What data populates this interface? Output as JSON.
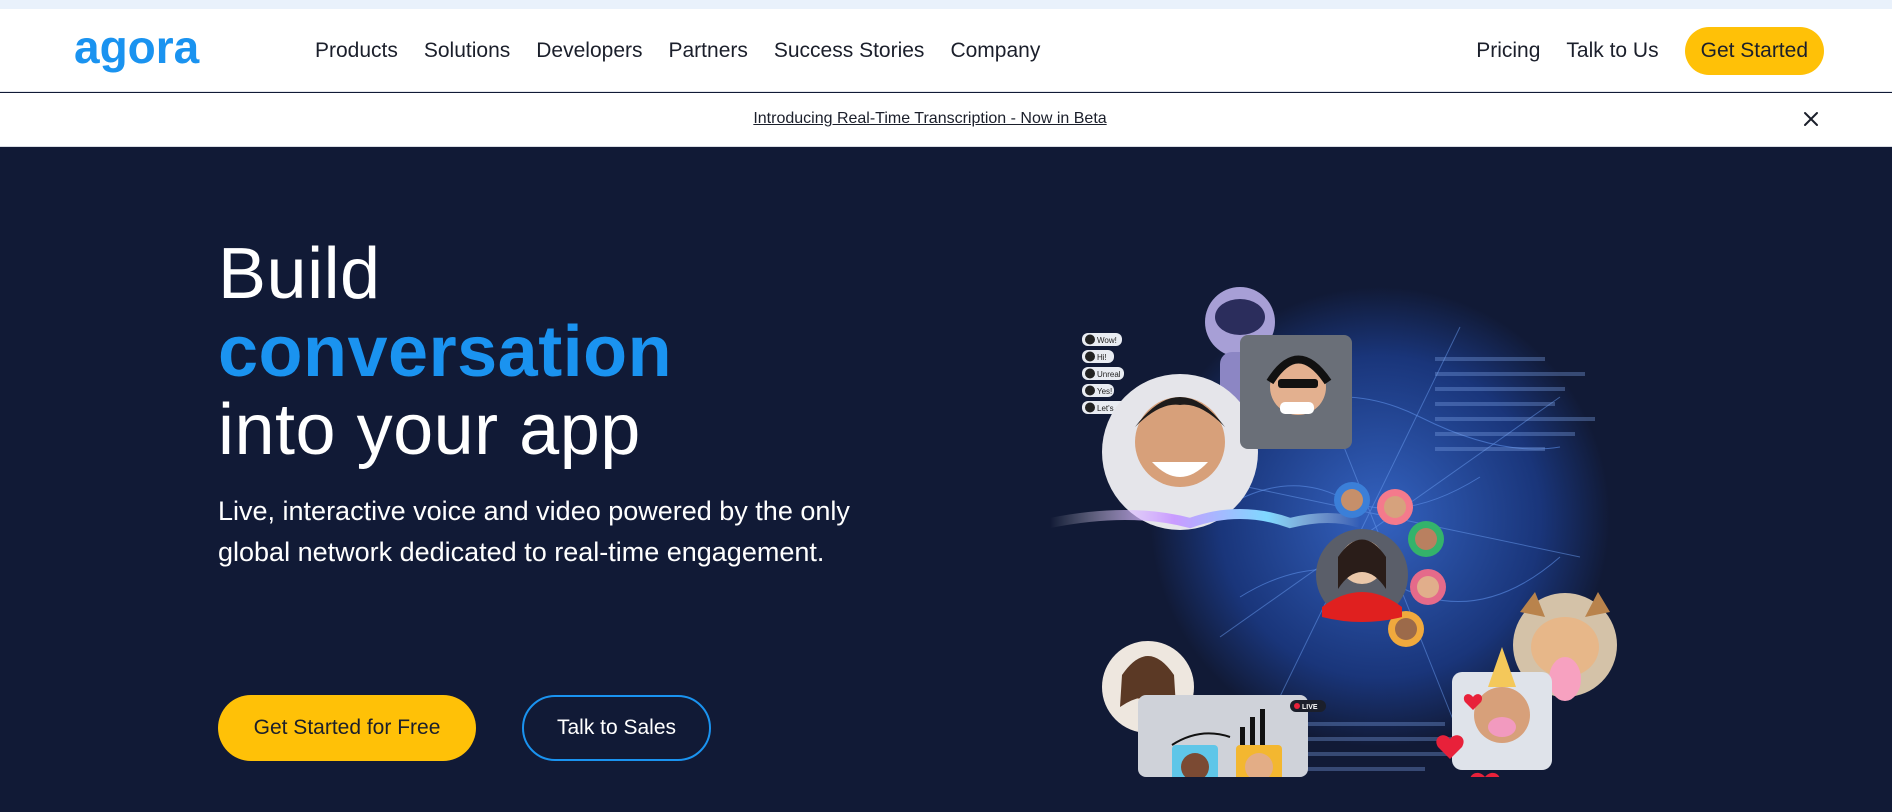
{
  "nav": {
    "brand": "agora",
    "links": [
      "Products",
      "Solutions",
      "Developers",
      "Partners",
      "Success Stories",
      "Company"
    ],
    "pricing": "Pricing",
    "talk": "Talk to Us",
    "get_started": "Get Started"
  },
  "banner": {
    "text": "Introducing Real-Time Transcription - Now in Beta",
    "close_icon": "close-icon"
  },
  "hero": {
    "title_line1": "Build",
    "title_line2": "conversation",
    "title_line3": "into your app",
    "subtitle": "Live, interactive voice and video powered by the only global network dedicated to real-time engagement.",
    "cta_primary": "Get Started for Free",
    "cta_secondary": "Talk to Sales"
  },
  "illustration": {
    "chat_chips": [
      "Wow!",
      "Hi!",
      "Unreal",
      "Yes!",
      "Let's go!"
    ],
    "live_badge": "LIVE"
  },
  "colors": {
    "brand_blue": "#1a93f0",
    "yellow": "#ffc107",
    "navy": "#111a36"
  }
}
